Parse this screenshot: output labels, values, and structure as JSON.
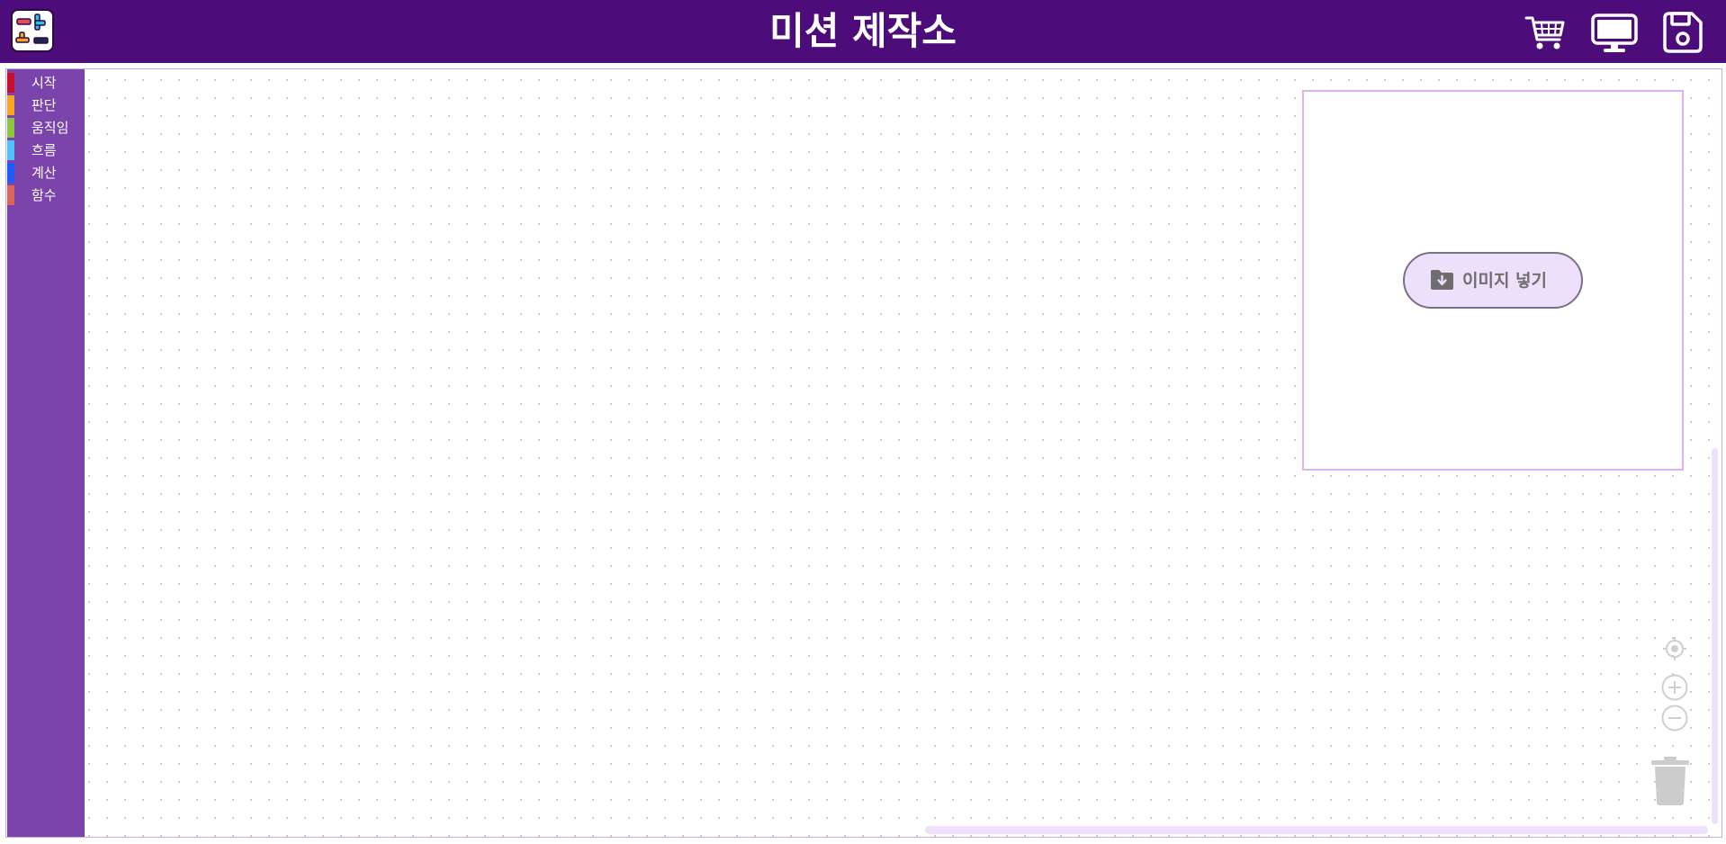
{
  "header": {
    "title": "미션 제작소",
    "background": "#4c0d7b",
    "buttons": [
      {
        "name": "cart-icon"
      },
      {
        "name": "monitor-icon"
      },
      {
        "name": "save-icon"
      }
    ]
  },
  "sidebar": {
    "background": "#7b44ab",
    "categories": [
      {
        "label": "시작",
        "color": "#c8102e"
      },
      {
        "label": "판단",
        "color": "#f5a623"
      },
      {
        "label": "움직임",
        "color": "#8cc63f"
      },
      {
        "label": "흐름",
        "color": "#4fc3f7"
      },
      {
        "label": "계산",
        "color": "#1e5bff"
      },
      {
        "label": "함수",
        "color": "#d9665b"
      }
    ]
  },
  "image_panel": {
    "insert_label": "이미지 넣기",
    "insert_icon": "folder-download-icon"
  },
  "controls": {
    "recenter": "target-icon",
    "zoom_in": "zoom-in-icon",
    "zoom_out": "zoom-out-icon",
    "trash": "trash-icon"
  }
}
